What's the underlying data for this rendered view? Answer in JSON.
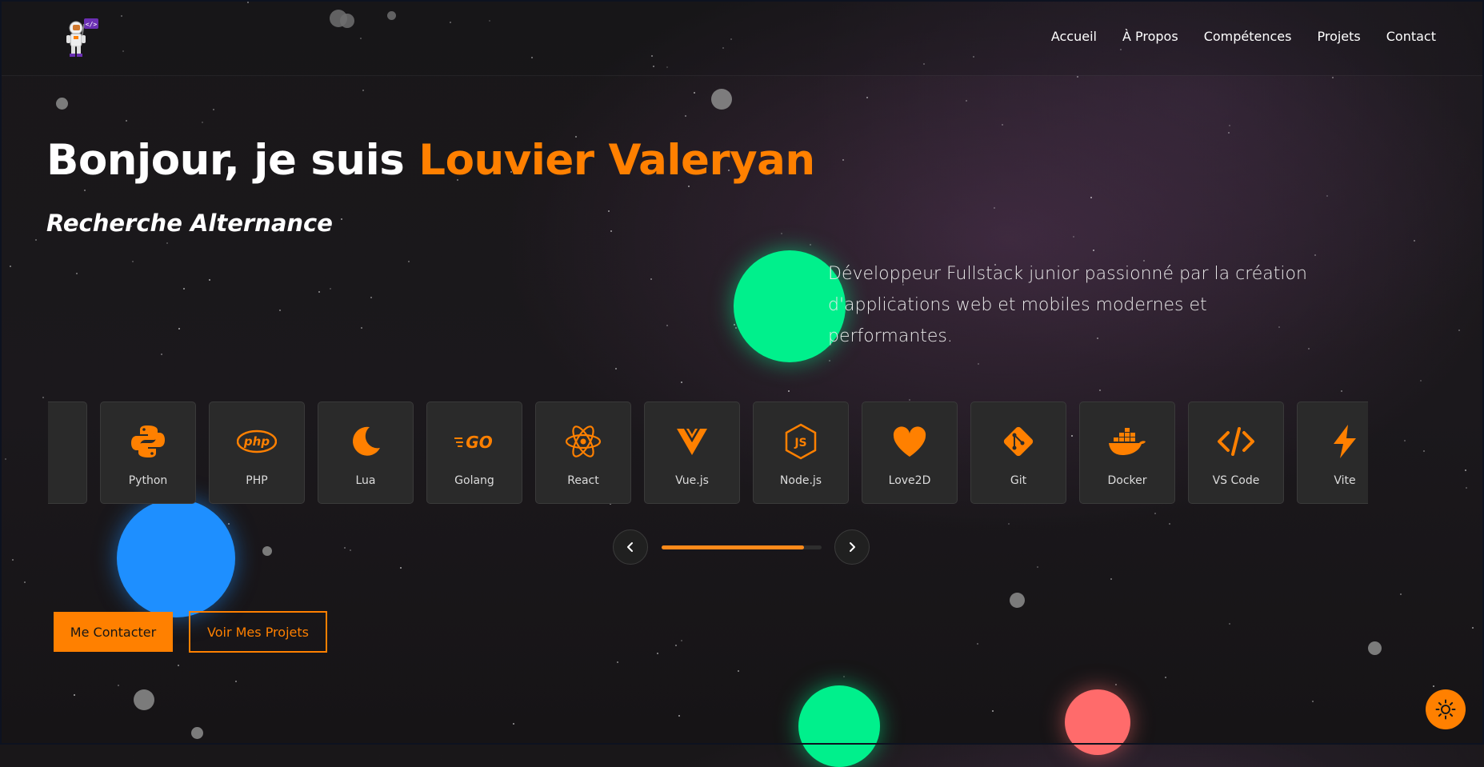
{
  "nav": {
    "items": [
      {
        "label": "Accueil"
      },
      {
        "label": "À Propos"
      },
      {
        "label": "Compétences"
      },
      {
        "label": "Projets"
      },
      {
        "label": "Contact"
      }
    ]
  },
  "hero": {
    "title_prefix": "Bonjour, je suis ",
    "title_name": "Louvier Valeryan",
    "subtitle": "Recherche Alternance",
    "description": "Développeur Fullstack junior passionné par la création d'applications web et mobiles modernes et performantes."
  },
  "skills": [
    {
      "label": "Python",
      "icon": "python-icon"
    },
    {
      "label": "PHP",
      "icon": "php-icon"
    },
    {
      "label": "Lua",
      "icon": "lua-moon-icon"
    },
    {
      "label": "Golang",
      "icon": "golang-icon"
    },
    {
      "label": "React",
      "icon": "react-atom-icon"
    },
    {
      "label": "Vue.js",
      "icon": "vue-icon"
    },
    {
      "label": "Node.js",
      "icon": "nodejs-icon"
    },
    {
      "label": "Love2D",
      "icon": "heart-icon"
    },
    {
      "label": "Git",
      "icon": "git-icon"
    },
    {
      "label": "Docker",
      "icon": "docker-whale-icon"
    },
    {
      "label": "VS Code",
      "icon": "code-brackets-icon"
    },
    {
      "label": "Vite",
      "icon": "lightning-bolt-icon"
    }
  ],
  "carousel": {
    "progress": 0.89
  },
  "buttons": {
    "contact": "Me Contacter",
    "projects": "Voir Mes Projets"
  },
  "colors": {
    "accent": "#ff8000",
    "orb_green": "#00f08c",
    "orb_blue": "#1e8fff",
    "orb_red": "#ff6b6b"
  }
}
